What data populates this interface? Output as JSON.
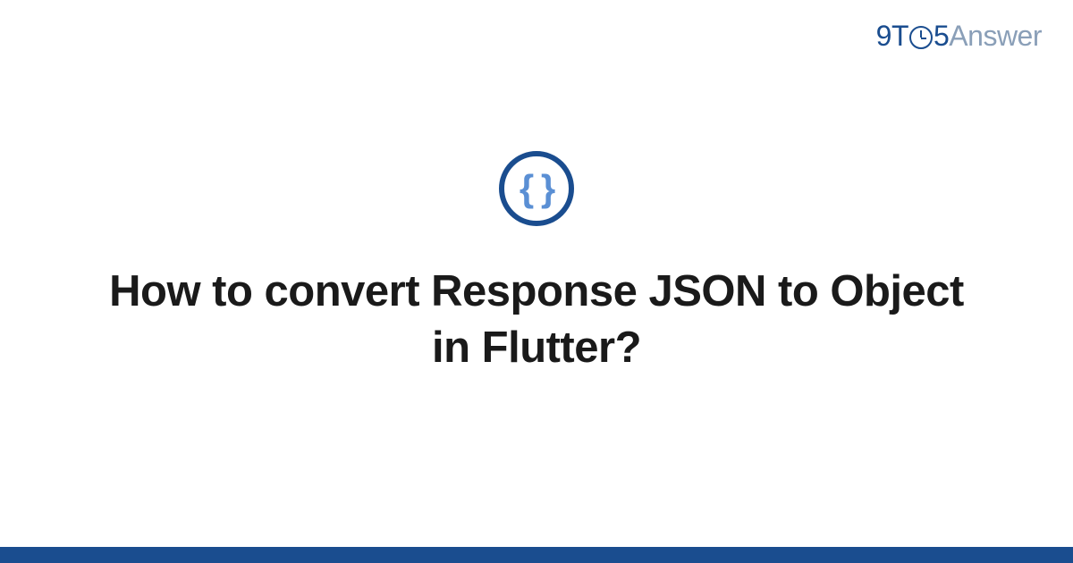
{
  "brand": {
    "part1": "9",
    "part2": "T",
    "part3": "5",
    "part4": "Answer"
  },
  "icon": {
    "braces": "{ }"
  },
  "question": {
    "title": "How to convert Response JSON to Object in Flutter?"
  },
  "colors": {
    "primary": "#1a4d8f",
    "muted": "#8a9fb8",
    "accent": "#5a8fd4"
  }
}
